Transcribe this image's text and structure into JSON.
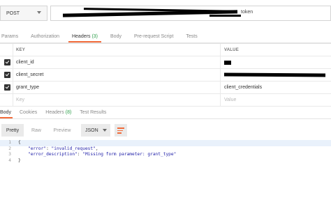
{
  "request": {
    "method": "POST",
    "url_visible_suffix": "token"
  },
  "request_tabs": [
    {
      "label": "Params"
    },
    {
      "label": "Authorization"
    },
    {
      "label": "Headers",
      "count": "(3)"
    },
    {
      "label": "Body"
    },
    {
      "label": "Pre-request Script"
    },
    {
      "label": "Tests"
    }
  ],
  "headers_table": {
    "col_key": "KEY",
    "col_value": "VALUE",
    "rows": [
      {
        "key": "client_id",
        "value": ""
      },
      {
        "key": "client_secret",
        "value": ""
      },
      {
        "key": "grant_type",
        "value": "client_credentials"
      }
    ],
    "placeholder_key": "Key",
    "placeholder_value": "Value"
  },
  "response_tabs": [
    {
      "label": "Body"
    },
    {
      "label": "Cookies"
    },
    {
      "label": "Headers",
      "count": "(8)"
    },
    {
      "label": "Test Results"
    }
  ],
  "response_toolbar": {
    "pretty": "Pretty",
    "raw": "Raw",
    "preview": "Preview",
    "format": "JSON"
  },
  "response_body": {
    "line_numbers": [
      "1",
      "2",
      "3",
      "4"
    ],
    "open_brace": "{",
    "close_brace": "}",
    "error_key": "\"error\"",
    "error_value": "\"invalid_request\"",
    "desc_key": "\"error_description\"",
    "desc_value": "\"Missing form parameter: grant_type\""
  },
  "colors": {
    "accent": "#f26b3a",
    "count_green": "#2a9d48",
    "json_blue": "#1e1ea8"
  }
}
